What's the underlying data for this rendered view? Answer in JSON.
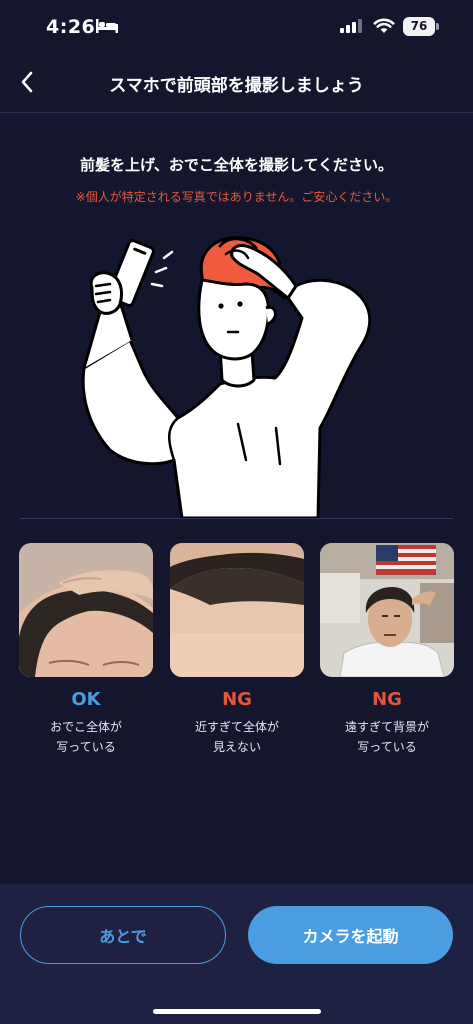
{
  "status_bar": {
    "time": "4:26",
    "battery": "76"
  },
  "nav": {
    "title": "スマホで前頭部を撮影しましょう",
    "back_icon": "chevron-left-icon"
  },
  "instruction": {
    "main": "前髪を上げ、おでこ全体を撮影してください。",
    "notice": "※個人が特定される写真ではありません。ご安心ください。"
  },
  "examples": [
    {
      "verdict": "OK",
      "caption_line1": "おでこ全体が",
      "caption_line2": "写っている"
    },
    {
      "verdict": "NG",
      "caption_line1": "近すぎて全体が",
      "caption_line2": "見えない"
    },
    {
      "verdict": "NG",
      "caption_line1": "遠すぎて背景が",
      "caption_line2": "写っている"
    }
  ],
  "buttons": {
    "later": "あとで",
    "camera": "カメラを起動"
  },
  "colors": {
    "background": "#14162e",
    "accent": "#4a9de0",
    "ng": "#e3553c",
    "notice": "#e25a3f",
    "hair": "#ef5b3c"
  }
}
